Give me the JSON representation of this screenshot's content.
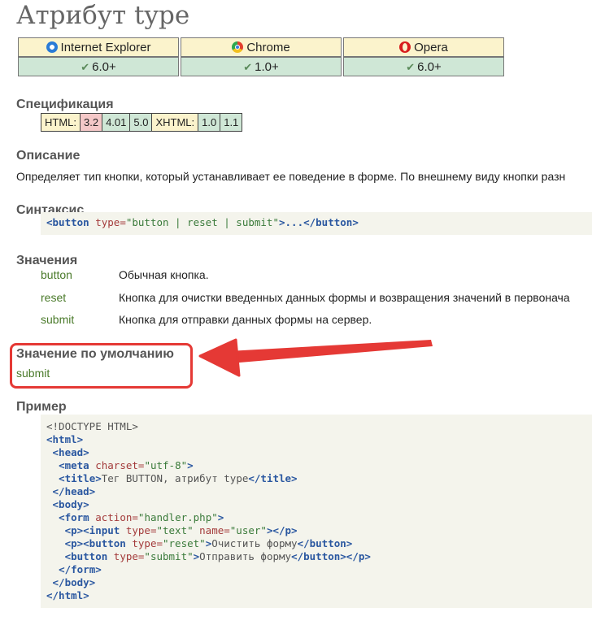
{
  "page": {
    "title": "Атрибут type"
  },
  "browsers": {
    "columns": [
      {
        "name": "Internet Explorer",
        "icon": "ie-icon",
        "version": "6.0+"
      },
      {
        "name": "Chrome",
        "icon": "chrome-icon",
        "version": "1.0+"
      },
      {
        "name": "Opera",
        "icon": "opera-icon",
        "version": "6.0+"
      }
    ]
  },
  "spec": {
    "heading": "Спецификация",
    "html_label": "HTML:",
    "html_versions": [
      "3.2",
      "4.01",
      "5.0"
    ],
    "xhtml_label": "XHTML:",
    "xhtml_versions": [
      "1.0",
      "1.1"
    ]
  },
  "description": {
    "heading": "Описание",
    "text": "Определяет тип кнопки, который устанавливает ее поведение в форме. По внешнему виду кнопки разн"
  },
  "syntax": {
    "heading": "Синтаксис",
    "open_tag": "<button",
    "attr": " type=",
    "value": "\"button | reset | submit\"",
    "middle": ">...",
    "close_tag": "</button>"
  },
  "values": {
    "heading": "Значения",
    "items": [
      {
        "key": "button",
        "desc": "Обычная кнопка."
      },
      {
        "key": "reset",
        "desc": "Кнопка для очистки введенных данных формы и возвращения значений в первонача"
      },
      {
        "key": "submit",
        "desc": "Кнопка для отправки данных формы на сервер."
      }
    ]
  },
  "default": {
    "heading": "Значение по умолчанию",
    "value": "submit",
    "highlight_color": "#e53935"
  },
  "example": {
    "heading": "Пример",
    "lines": [
      {
        "parts": [
          {
            "t": "pl",
            "v": "<!DOCTYPE HTML>"
          }
        ]
      },
      {
        "parts": [
          {
            "t": "tg",
            "v": "<html>"
          }
        ]
      },
      {
        "parts": [
          {
            "t": "pl",
            "v": " "
          },
          {
            "t": "tg",
            "v": "<head>"
          }
        ]
      },
      {
        "parts": [
          {
            "t": "pl",
            "v": "  "
          },
          {
            "t": "tg",
            "v": "<meta"
          },
          {
            "t": "at",
            "v": " charset="
          },
          {
            "t": "st",
            "v": "\"utf-8\""
          },
          {
            "t": "tg",
            "v": ">"
          }
        ]
      },
      {
        "parts": [
          {
            "t": "pl",
            "v": "  "
          },
          {
            "t": "tg",
            "v": "<title>"
          },
          {
            "t": "pl",
            "v": "Тег BUTTON, атрибут type"
          },
          {
            "t": "tg",
            "v": "</title>"
          }
        ]
      },
      {
        "parts": [
          {
            "t": "pl",
            "v": " "
          },
          {
            "t": "tg",
            "v": "</head>"
          }
        ]
      },
      {
        "parts": [
          {
            "t": "pl",
            "v": " "
          },
          {
            "t": "tg",
            "v": "<body>"
          }
        ]
      },
      {
        "parts": [
          {
            "t": "pl",
            "v": "  "
          },
          {
            "t": "tg",
            "v": "<form"
          },
          {
            "t": "at",
            "v": " action="
          },
          {
            "t": "st",
            "v": "\"handler.php\""
          },
          {
            "t": "tg",
            "v": ">"
          }
        ]
      },
      {
        "parts": [
          {
            "t": "pl",
            "v": "   "
          },
          {
            "t": "tg",
            "v": "<p><input"
          },
          {
            "t": "at",
            "v": " type="
          },
          {
            "t": "st",
            "v": "\"text\""
          },
          {
            "t": "at",
            "v": " name="
          },
          {
            "t": "st",
            "v": "\"user\""
          },
          {
            "t": "tg",
            "v": "></p>"
          }
        ]
      },
      {
        "parts": [
          {
            "t": "pl",
            "v": "   "
          },
          {
            "t": "tg",
            "v": "<p><button"
          },
          {
            "t": "at",
            "v": " type="
          },
          {
            "t": "st",
            "v": "\"reset\""
          },
          {
            "t": "tg",
            "v": ">"
          },
          {
            "t": "pl",
            "v": "Очистить форму"
          },
          {
            "t": "tg",
            "v": "</button>"
          }
        ]
      },
      {
        "parts": [
          {
            "t": "pl",
            "v": "   "
          },
          {
            "t": "tg",
            "v": "<button"
          },
          {
            "t": "at",
            "v": " type="
          },
          {
            "t": "st",
            "v": "\"submit\""
          },
          {
            "t": "tg",
            "v": ">"
          },
          {
            "t": "pl",
            "v": "Отправить форму"
          },
          {
            "t": "tg",
            "v": "</button></p>"
          }
        ]
      },
      {
        "parts": [
          {
            "t": "pl",
            "v": "  "
          },
          {
            "t": "tg",
            "v": "</form>"
          }
        ]
      },
      {
        "parts": [
          {
            "t": "pl",
            "v": " "
          },
          {
            "t": "tg",
            "v": "</body>"
          }
        ]
      },
      {
        "parts": [
          {
            "t": "tg",
            "v": "</html>"
          }
        ]
      }
    ]
  }
}
